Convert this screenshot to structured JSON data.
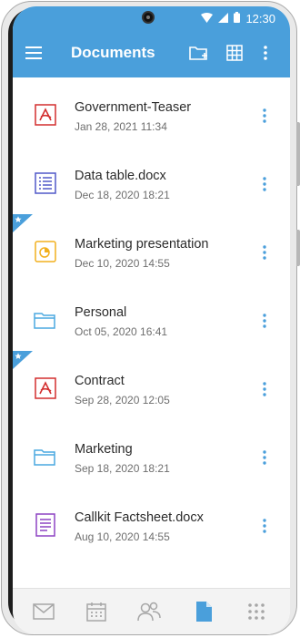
{
  "status_bar": {
    "time": "12:30"
  },
  "app_bar": {
    "title": "Documents"
  },
  "documents": [
    {
      "name": "Government-Teaser",
      "date": "Jan 28, 2021 11:34",
      "type": "pdf",
      "starred": false
    },
    {
      "name": "Data table.docx",
      "date": "Dec 18, 2020 18:21",
      "type": "table",
      "starred": false
    },
    {
      "name": "Marketing presentation",
      "date": "Dec 10, 2020 14:55",
      "type": "presentation",
      "starred": true
    },
    {
      "name": "Personal",
      "date": "Oct 05, 2020 16:41",
      "type": "folder",
      "starred": false
    },
    {
      "name": "Contract",
      "date": "Sep 28, 2020 12:05",
      "type": "pdf",
      "starred": true
    },
    {
      "name": "Marketing",
      "date": "Sep 18, 2020 18:21",
      "type": "folder",
      "starred": false
    },
    {
      "name": "Callkit Factsheet.docx",
      "date": "Aug 10, 2020 14:55",
      "type": "document",
      "starred": false
    }
  ],
  "bottom_nav": [
    {
      "icon": "mail-icon",
      "active": false
    },
    {
      "icon": "calendar-icon",
      "active": false
    },
    {
      "icon": "contacts-icon",
      "active": false
    },
    {
      "icon": "documents-icon",
      "active": true
    },
    {
      "icon": "apps-grid-icon",
      "active": false
    }
  ],
  "colors": {
    "brand": "#4a9fdb",
    "pdf": "#d32f2f",
    "table": "#5058c8",
    "presentation": "#f2b01e",
    "folder": "#4aa8e0",
    "document": "#8e44c4",
    "nav_inactive": "#a6a6a6",
    "nav_active": "#4a9fdb"
  }
}
